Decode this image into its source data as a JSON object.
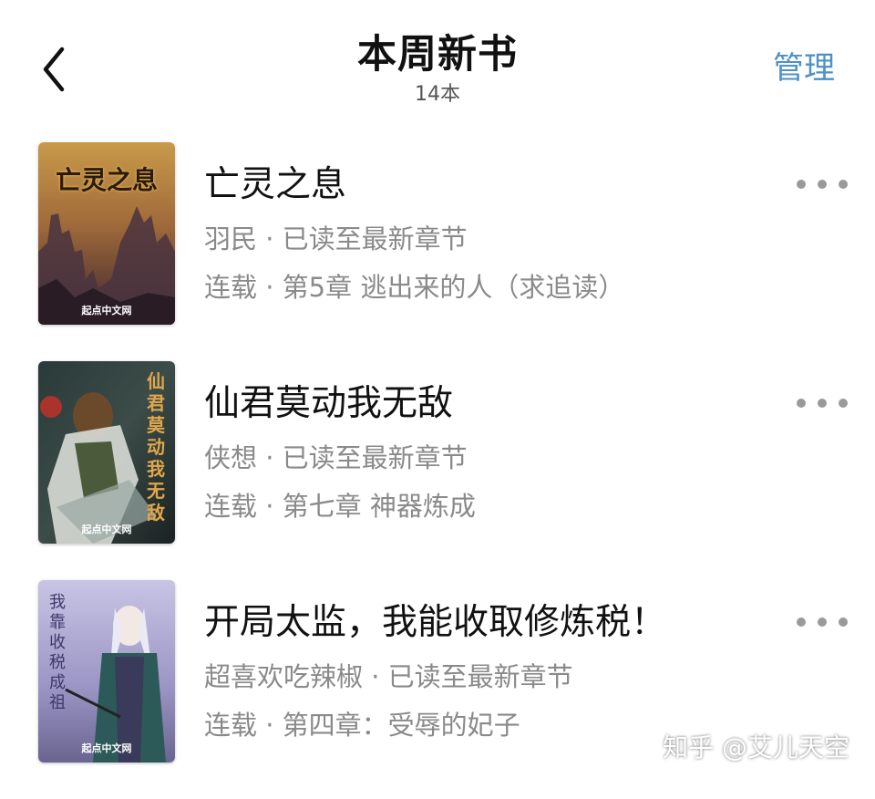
{
  "header": {
    "title": "本周新书",
    "subtitle": "14本",
    "manage_label": "管理"
  },
  "books": [
    {
      "title": "亡灵之息",
      "meta": "羽民 · 已读至最新章节",
      "chapter": "连载 · 第5章 逃出来的人（求追读）",
      "cover_title": "亡灵之息",
      "cover_publisher": "起点中文网"
    },
    {
      "title": "仙君莫动我无敌",
      "meta": "侠想 · 已读至最新章节",
      "chapter": "连载 · 第七章 神器炼成",
      "cover_title": "仙君莫动我无敌",
      "cover_publisher": "起点中文网"
    },
    {
      "title": "开局太监，我能收取修炼税！",
      "meta": "超喜欢吃辣椒 · 已读至最新章节",
      "chapter": "连载 · 第四章：受辱的妃子",
      "cover_title": "我靠收税成祖",
      "cover_publisher": "起点中文网"
    }
  ],
  "watermark": "知乎 @艾儿天空",
  "colors": {
    "accent": "#4e90c8",
    "meta_text": "#8a8a8a"
  },
  "icons": {
    "back": "chevron-left-icon",
    "more": "more-dots-icon"
  }
}
